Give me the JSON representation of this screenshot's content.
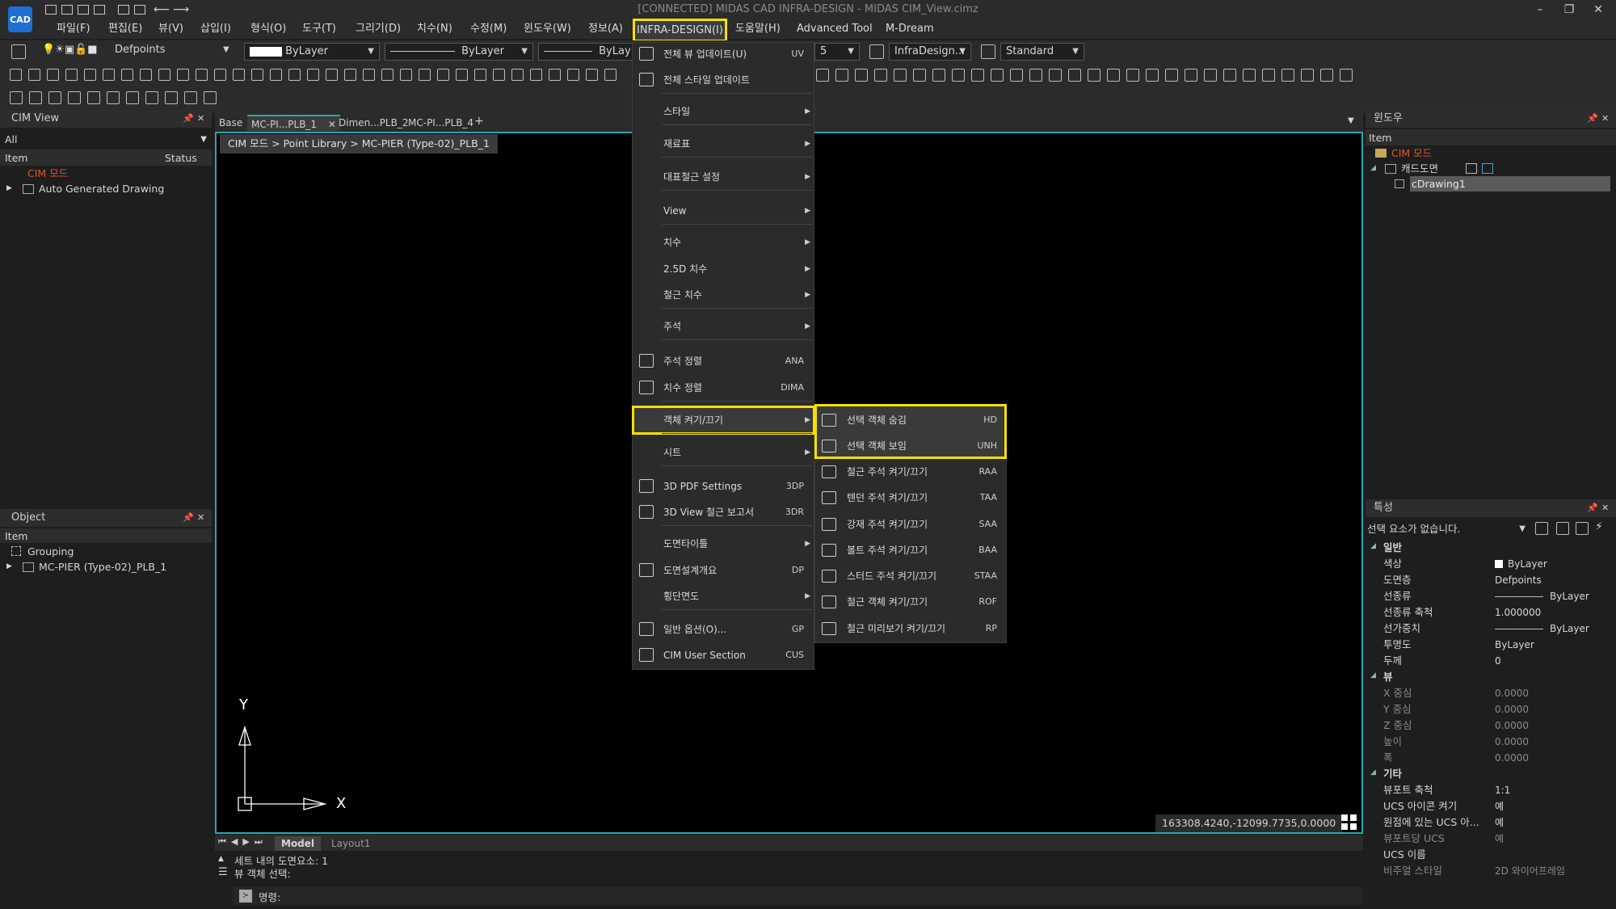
{
  "app": {
    "logo": "CAD",
    "window_title": "[CONNECTED] MIDAS CAD INFRA-DESIGN - MIDAS CIM_View.cimz",
    "controls": [
      "–",
      "❐",
      "✕"
    ]
  },
  "menubar": {
    "items": [
      "파일(F)",
      "편집(E)",
      "뷰(V)",
      "삽입(I)",
      "형식(O)",
      "도구(T)",
      "그리기(D)",
      "치수(N)",
      "수정(M)",
      "윈도우(W)",
      "정보(A)"
    ],
    "active": "INFRA-DESIGN(I)",
    "after": [
      "도움말(H)",
      "Advanced Tool",
      "M-Dream"
    ]
  },
  "toolbar": {
    "layer": "Defpoints",
    "color": "ByLayer",
    "linetype": "ByLayer",
    "lineweight": "ByLay",
    "dimstyle_num": "5",
    "dimstyle": "InfraDesign...",
    "textstyle": "Standard"
  },
  "cim_view": {
    "title": "CIM View",
    "filter": "All",
    "col_item": "Item",
    "col_status": "Status",
    "rows": [
      "CIM 모드",
      "Auto Generated Drawing"
    ]
  },
  "object_panel": {
    "title": "Object",
    "col_item": "Item",
    "rows": [
      "Grouping",
      "MC-PIER (Type-02)_PLB_1"
    ]
  },
  "doc_tabs": [
    "Base",
    "MC-PI...PLB_1",
    "Dimen...PLB_2",
    "MC-PI...PLB_4"
  ],
  "breadcrumb": "CIM 모드 > Point Library > MC-PIER (Type-02)_PLB_1",
  "dropdown": {
    "items": [
      {
        "label": "전체 뷰 업데이트(U)",
        "shortcut": "UV",
        "icon": "update-view-icon"
      },
      {
        "label": "전체 스타일 업데이트",
        "shortcut": "",
        "icon": "update-style-icon"
      },
      {
        "label": "스타일",
        "submenu": true
      },
      {
        "label": "재료표",
        "submenu": true
      },
      {
        "label": "대표철근 설정",
        "submenu": true
      },
      {
        "label": "View",
        "submenu": true
      },
      {
        "label": "치수",
        "submenu": true
      },
      {
        "label": "2.5D 치수",
        "submenu": true
      },
      {
        "label": "철근 치수",
        "submenu": true
      },
      {
        "label": "주석",
        "submenu": true
      },
      {
        "label": "주석 정렬",
        "shortcut": "ANA",
        "icon": "annotation-align-icon"
      },
      {
        "label": "치수 정렬",
        "shortcut": "DIMA",
        "icon": "dimension-align-icon"
      },
      {
        "label": "객체 켜기/끄기",
        "submenu": true
      },
      {
        "label": "시트",
        "submenu": true
      },
      {
        "label": "3D PDF Settings",
        "shortcut": "3DP",
        "icon": "pdf-settings-icon"
      },
      {
        "label": "3D View 철근 보고서",
        "shortcut": "3DR",
        "icon": "rebar-report-icon"
      },
      {
        "label": "도면타이틀",
        "submenu": true
      },
      {
        "label": "도면설계개요",
        "shortcut": "DP",
        "icon": "design-overview-icon"
      },
      {
        "label": "횡단면도",
        "submenu": true
      },
      {
        "label": "일반 옵션(O)...",
        "shortcut": "GP",
        "icon": "gear-icon"
      },
      {
        "label": "CIM User Section",
        "shortcut": "CUS",
        "icon": "user-section-icon"
      }
    ]
  },
  "submenu": {
    "items": [
      {
        "label": "선택 객체 숨김",
        "shortcut": "HD"
      },
      {
        "label": "선택 객체 보임",
        "shortcut": "UNH"
      },
      {
        "label": "철근 주석 켜기/끄기",
        "shortcut": "RAA"
      },
      {
        "label": "텐던 주석 켜기/끄기",
        "shortcut": "TAA"
      },
      {
        "label": "강재 주석 켜기/끄기",
        "shortcut": "SAA"
      },
      {
        "label": "볼트 주석 켜기/끄기",
        "shortcut": "BAA"
      },
      {
        "label": "스터드 주석 켜기/끄기",
        "shortcut": "STAA"
      },
      {
        "label": "철근 객체 켜기/끄기",
        "shortcut": "ROF"
      },
      {
        "label": "철근 미리보기 켜기/끄기",
        "shortcut": "RP"
      }
    ]
  },
  "window_panel": {
    "title": "윈도우",
    "col_item": "Item",
    "rows": [
      "CIM 모드",
      "캐드도면",
      "cDrawing1"
    ]
  },
  "props_panel": {
    "title": "특성",
    "selection": "선택 요소가 없습니다.",
    "groups": [
      {
        "name": "일반",
        "rows": [
          {
            "k": "색상",
            "v": "ByLayer"
          },
          {
            "k": "도면층",
            "v": "Defpoints"
          },
          {
            "k": "선종류",
            "v": "ByLayer"
          },
          {
            "k": "선종류 축척",
            "v": "1.000000"
          },
          {
            "k": "선가중치",
            "v": "ByLayer"
          },
          {
            "k": "투명도",
            "v": "ByLayer"
          },
          {
            "k": "두께",
            "v": "0"
          }
        ]
      },
      {
        "name": "뷰",
        "rows": [
          {
            "k": "X 중심",
            "v": "0.0000"
          },
          {
            "k": "Y 중심",
            "v": "0.0000"
          },
          {
            "k": "Z 중심",
            "v": "0.0000"
          },
          {
            "k": "높이",
            "v": "0.0000"
          },
          {
            "k": "폭",
            "v": "0.0000"
          }
        ]
      },
      {
        "name": "기타",
        "rows": [
          {
            "k": "뷰포트 축척",
            "v": "1:1"
          },
          {
            "k": "UCS 아이콘 켜기",
            "v": "예"
          },
          {
            "k": "원점에 있는 UCS 아...",
            "v": "예"
          },
          {
            "k": "뷰포트당 UCS",
            "v": "예"
          },
          {
            "k": "UCS 이름",
            "v": ""
          },
          {
            "k": "비주얼 스타일",
            "v": "2D 와이어프레임"
          }
        ]
      }
    ]
  },
  "canvas": {
    "coords": "163308.4240,-12099.7735,0.0000",
    "axis_x": "X",
    "axis_y": "Y"
  },
  "layout_tabs": [
    "Model",
    "Layout1"
  ],
  "command": {
    "lines": [
      "세트 내의 도면요소: 1",
      "뷰 객체 선택:"
    ],
    "prompt": "명령:"
  }
}
